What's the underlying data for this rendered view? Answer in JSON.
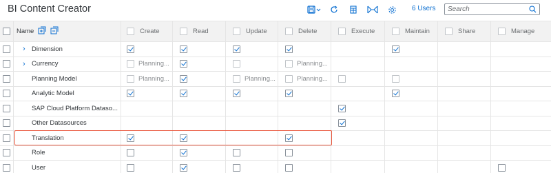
{
  "app": {
    "title": "BI Content Creator"
  },
  "toolbar": {
    "save_icon": "save-dropdown-icon",
    "users_label": "6 Users",
    "search_placeholder": "Search"
  },
  "columns": {
    "name": "Name",
    "create": "Create",
    "read": "Read",
    "update": "Update",
    "delete": "Delete",
    "execute": "Execute",
    "maintain": "Maintain",
    "share": "Share",
    "manage": "Manage"
  },
  "rows": [
    {
      "name": "Dimension",
      "expandable": true,
      "create": "checked",
      "read": "checked",
      "update": "checked",
      "delete": "checked",
      "execute": "none",
      "maintain": "checked",
      "share": "none",
      "manage": "none"
    },
    {
      "name": "Currency",
      "expandable": true,
      "create": "planning",
      "read": "checked",
      "update": "disabled",
      "delete": "planning",
      "execute": "none",
      "maintain": "none",
      "share": "none",
      "manage": "none"
    },
    {
      "name": "Planning Model",
      "expandable": false,
      "create": "planning",
      "read": "checked",
      "update": "planning",
      "delete": "planning",
      "execute": "disabled",
      "maintain": "disabled",
      "share": "none",
      "manage": "none"
    },
    {
      "name": "Analytic Model",
      "expandable": false,
      "create": "checked",
      "read": "checked",
      "update": "checked",
      "delete": "checked",
      "execute": "none",
      "maintain": "checked",
      "share": "none",
      "manage": "none"
    },
    {
      "name": "SAP Cloud Platform Dataso...",
      "expandable": false,
      "create": "none",
      "read": "none",
      "update": "none",
      "delete": "none",
      "execute": "checked",
      "maintain": "none",
      "share": "none",
      "manage": "none"
    },
    {
      "name": "Other Datasources",
      "expandable": false,
      "create": "none",
      "read": "none",
      "update": "none",
      "delete": "none",
      "execute": "checked",
      "maintain": "none",
      "share": "none",
      "manage": "none"
    },
    {
      "name": "Translation",
      "expandable": false,
      "create": "checked",
      "read": "checked",
      "update": "none",
      "delete": "checked",
      "execute": "none",
      "maintain": "none",
      "share": "none",
      "manage": "none"
    },
    {
      "name": "Role",
      "expandable": false,
      "create": "unchecked",
      "read": "checked",
      "update": "unchecked",
      "delete": "unchecked",
      "execute": "none",
      "maintain": "none",
      "share": "none",
      "manage": "none"
    },
    {
      "name": "User",
      "expandable": false,
      "create": "unchecked",
      "read": "checked",
      "update": "unchecked",
      "delete": "unchecked",
      "execute": "none",
      "maintain": "none",
      "share": "none",
      "manage": "unchecked"
    }
  ],
  "planning_label": "Planning...",
  "colors": {
    "accent": "#0a6ed1",
    "highlight": "#e9573d",
    "header_bg": "#f2f2f2"
  }
}
